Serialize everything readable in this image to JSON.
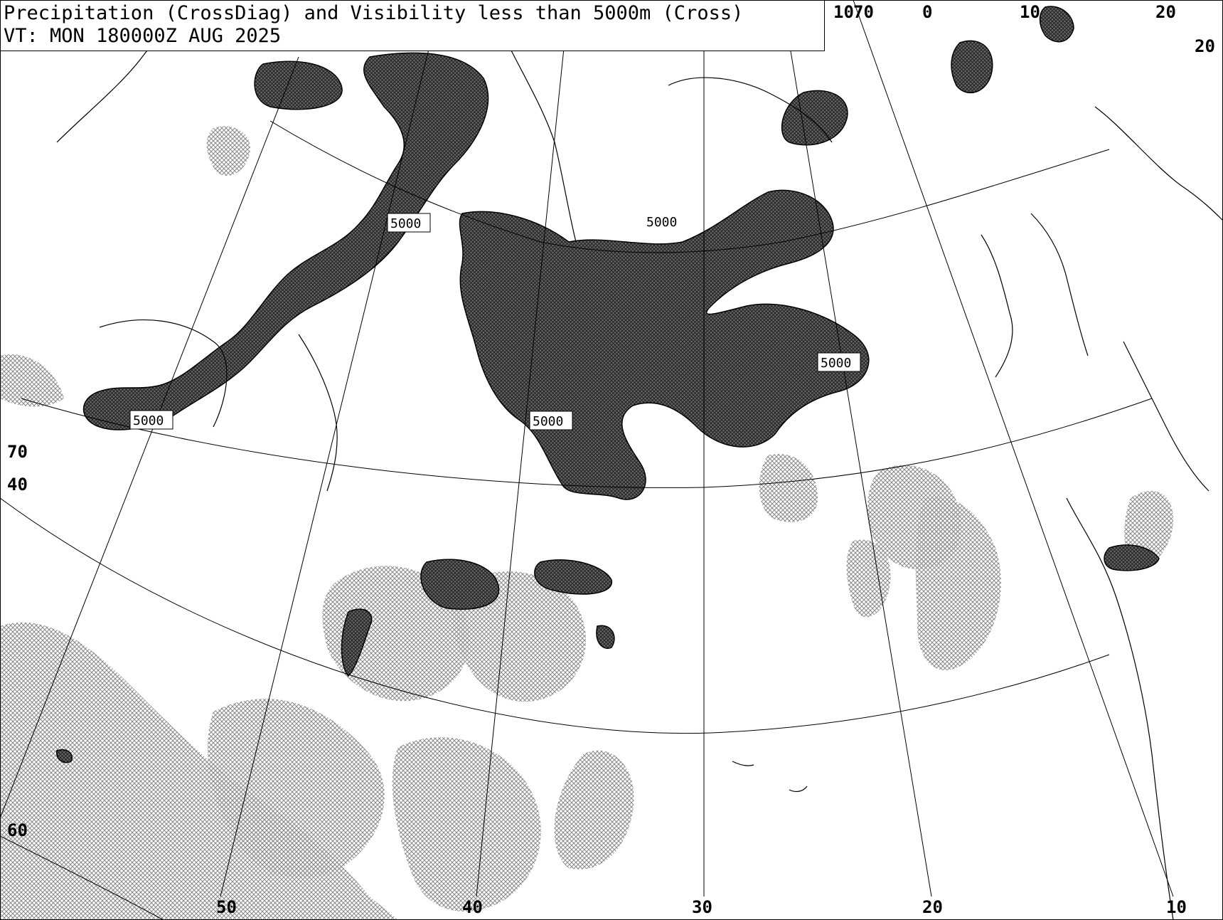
{
  "title": {
    "line1": "Precipitation (CrossDiag) and Visibility less than 5000m (Cross)",
    "line2": "VT: MON 180000Z AUG 2025"
  },
  "meridian_labels": {
    "lon_50": "50",
    "lon_40": "40",
    "lon_30": "30",
    "lon_20": "20",
    "lon_10": "10",
    "top_10": "10",
    "top_0": "0",
    "top_10e": "10",
    "top_20e": "20",
    "top_20e_b": "20"
  },
  "parallel_labels": {
    "lat_70_top": "70",
    "lat_70_left": "70",
    "lat_40": "40",
    "lat_60": "60"
  },
  "contour_label": "5000",
  "colors": {
    "precip_fill": "#aaaaaa",
    "low_vis_fill": "#5a5a5a",
    "line": "#000000",
    "background": "#ffffff"
  }
}
